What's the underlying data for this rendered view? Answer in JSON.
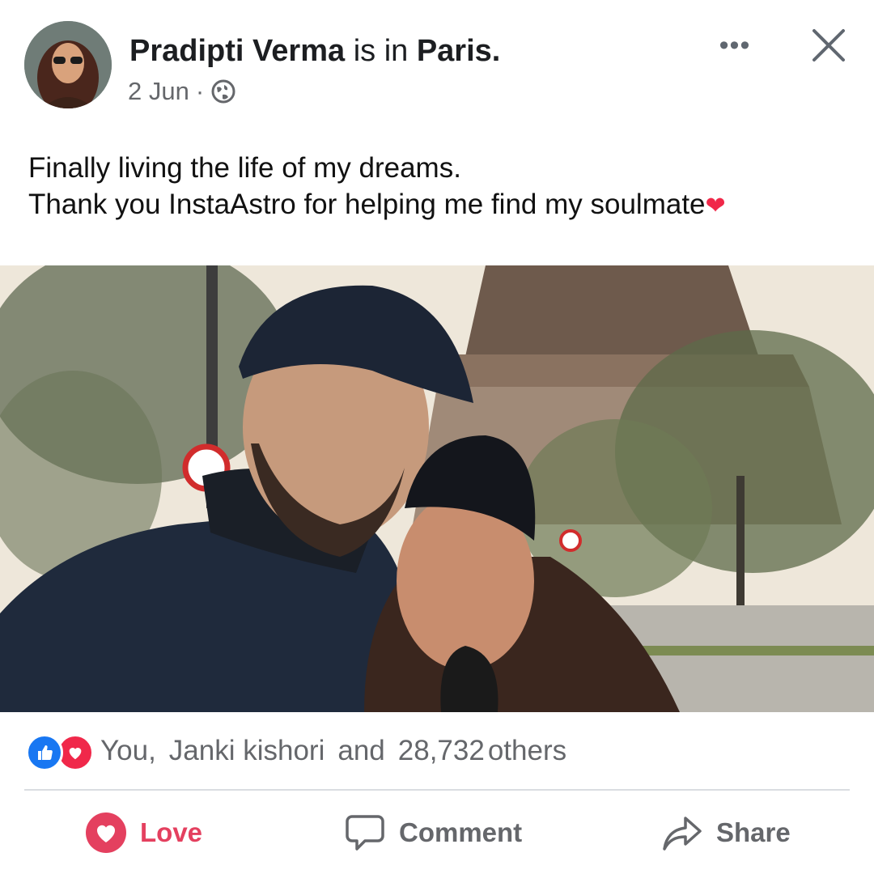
{
  "post": {
    "author": "Pradipti Verma",
    "connector": "is in",
    "location": "Paris.",
    "date": "2 Jun",
    "meta_separator": "·",
    "privacy_icon": "globe-icon",
    "text_line1": "Finally living the life of my dreams.",
    "text_line2": "Thank you InstaAstro for helping me find my soulmate",
    "text_emoji": "❤"
  },
  "header": {
    "more_icon": "more-options-icon",
    "more_label": "•••",
    "close_icon": "close-icon"
  },
  "reactions": {
    "icons": [
      "like-reaction-icon",
      "love-reaction-icon"
    ],
    "name1": "You,",
    "name2": "Janki kishori",
    "and": "and",
    "count": "28,732",
    "others": "others"
  },
  "actions": {
    "love_label": "Love",
    "comment_label": "Comment",
    "share_label": "Share"
  },
  "colors": {
    "love_red": "#e4405f",
    "like_blue": "#1877f2",
    "muted_text": "#65676b"
  }
}
